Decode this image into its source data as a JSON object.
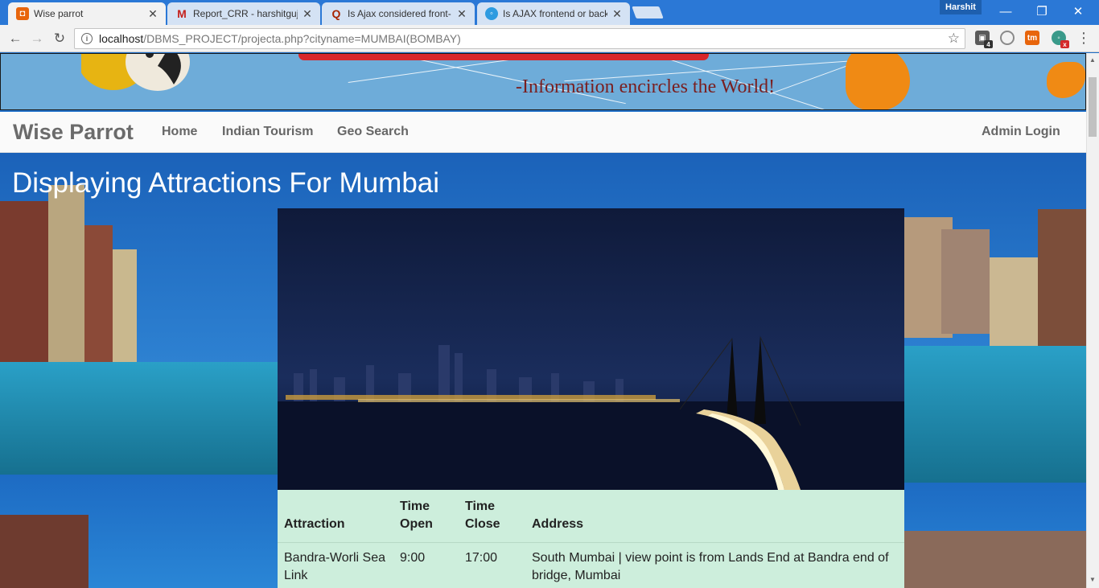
{
  "browser": {
    "tabs": [
      {
        "title": "Wise parrot",
        "active": true,
        "favicon": "wise-parrot-favicon"
      },
      {
        "title": "Report_CRR - harshitguj",
        "active": false,
        "favicon": "gmail-icon"
      },
      {
        "title": "Is Ajax considered front-",
        "active": false,
        "favicon": "quora-icon"
      },
      {
        "title": "Is AJAX frontend or back",
        "active": false,
        "favicon": "chat-bubble-icon"
      }
    ],
    "profile_name": "Harshit",
    "address": {
      "host": "localhost",
      "path": "/DBMS_PROJECT/projecta.php?cityname=MUMBAI(BOMBAY)"
    },
    "extensions": [
      {
        "name": "extension-cube-icon",
        "badge": "4",
        "color": "#5a5a5a"
      },
      {
        "name": "extension-circle-icon",
        "badge": "",
        "color": "#8a8a8a"
      },
      {
        "name": "extension-tm-icon",
        "badge": "",
        "color": "#e8650c"
      },
      {
        "name": "extension-chat-icon",
        "badge": "x",
        "color": "#3a9a8a"
      }
    ]
  },
  "banner": {
    "tagline": "-Information encircles the World!"
  },
  "navbar": {
    "brand": "Wise Parrot",
    "links": [
      "Home",
      "Indian Tourism",
      "Geo Search"
    ],
    "admin_login": "Admin Login"
  },
  "main": {
    "heading": "Displaying Attractions For Mumbai",
    "table": {
      "headers": [
        "Attraction",
        "Time Open",
        "Time Close",
        "Address"
      ],
      "rows": [
        [
          "Bandra-Worli Sea Link",
          "9:00",
          "17:00",
          "South Mumbai | view point is from Lands End at Bandra end of bridge, Mumbai"
        ]
      ]
    }
  },
  "colors": {
    "tabstrip": "#2b78d6",
    "table_bg": "#cdeedc",
    "tagline": "#7a1e1e",
    "navbar_text": "#666666"
  }
}
